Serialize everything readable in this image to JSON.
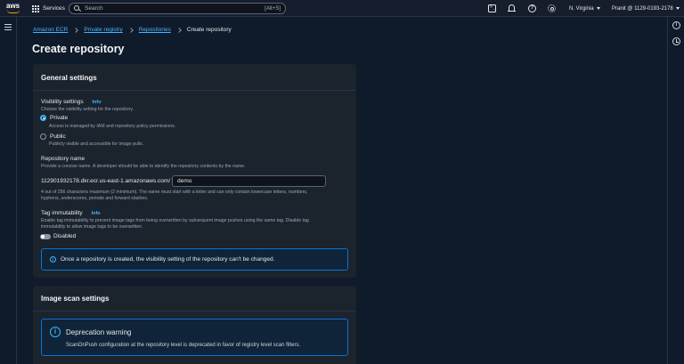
{
  "topnav": {
    "brand": "aws",
    "services_label": "Services",
    "search_placeholder": "Search",
    "search_shortcut": "[Alt+S]",
    "region": "N. Virginia",
    "account": "Pranit @ 1129-0193-2178"
  },
  "breadcrumb": {
    "items": [
      "Amazon ECR",
      "Private registry",
      "Repositories"
    ],
    "current": "Create repository"
  },
  "page": {
    "title": "Create repository"
  },
  "general": {
    "header": "General settings",
    "visibility": {
      "label": "Visibility settings",
      "info": "Info",
      "desc": "Choose the visibility setting for the repository.",
      "private_label": "Private",
      "private_desc": "Access is managed by IAM and repository policy permissions.",
      "public_label": "Public",
      "public_desc": "Publicly visible and accessible for image pulls.",
      "selected": "Private"
    },
    "repo_name": {
      "label": "Repository name",
      "desc": "Provide a concise name. A developer should be able to identify the repository contents by the name.",
      "prefix": "112901932178.dkr.ecr.us-east-1.amazonaws.com/",
      "value": "demo",
      "hint_line1": "4 out of 256 characters maximum (2 minimum). The name must start with a letter and can only contain lowercase letters, numbers,",
      "hint_line2": "hyphens, underscores, periods and forward slashes."
    },
    "tag_immutability": {
      "label": "Tag immutability",
      "info": "Info",
      "desc_line1": "Enable tag immutability to prevent image tags from being overwritten by subsequent image pushes using the same tag. Disable tag",
      "desc_line2": "immutability to allow image tags to be overwritten.",
      "toggle_label": "Disabled",
      "enabled": false
    },
    "alert": "Once a repository is created, the visibility setting of the repository can't be changed."
  },
  "scan": {
    "header": "Image scan settings",
    "warning_title": "Deprecation warning",
    "warning_body": "ScanOnPush configuration at the repository level is deprecated in favor of registry level scan filters."
  },
  "colors": {
    "accent": "#42b4ff",
    "background": "#0f1b2a",
    "panel": "#1b232d",
    "info_border": "#0972d3",
    "aws_orange": "#ff9900"
  }
}
